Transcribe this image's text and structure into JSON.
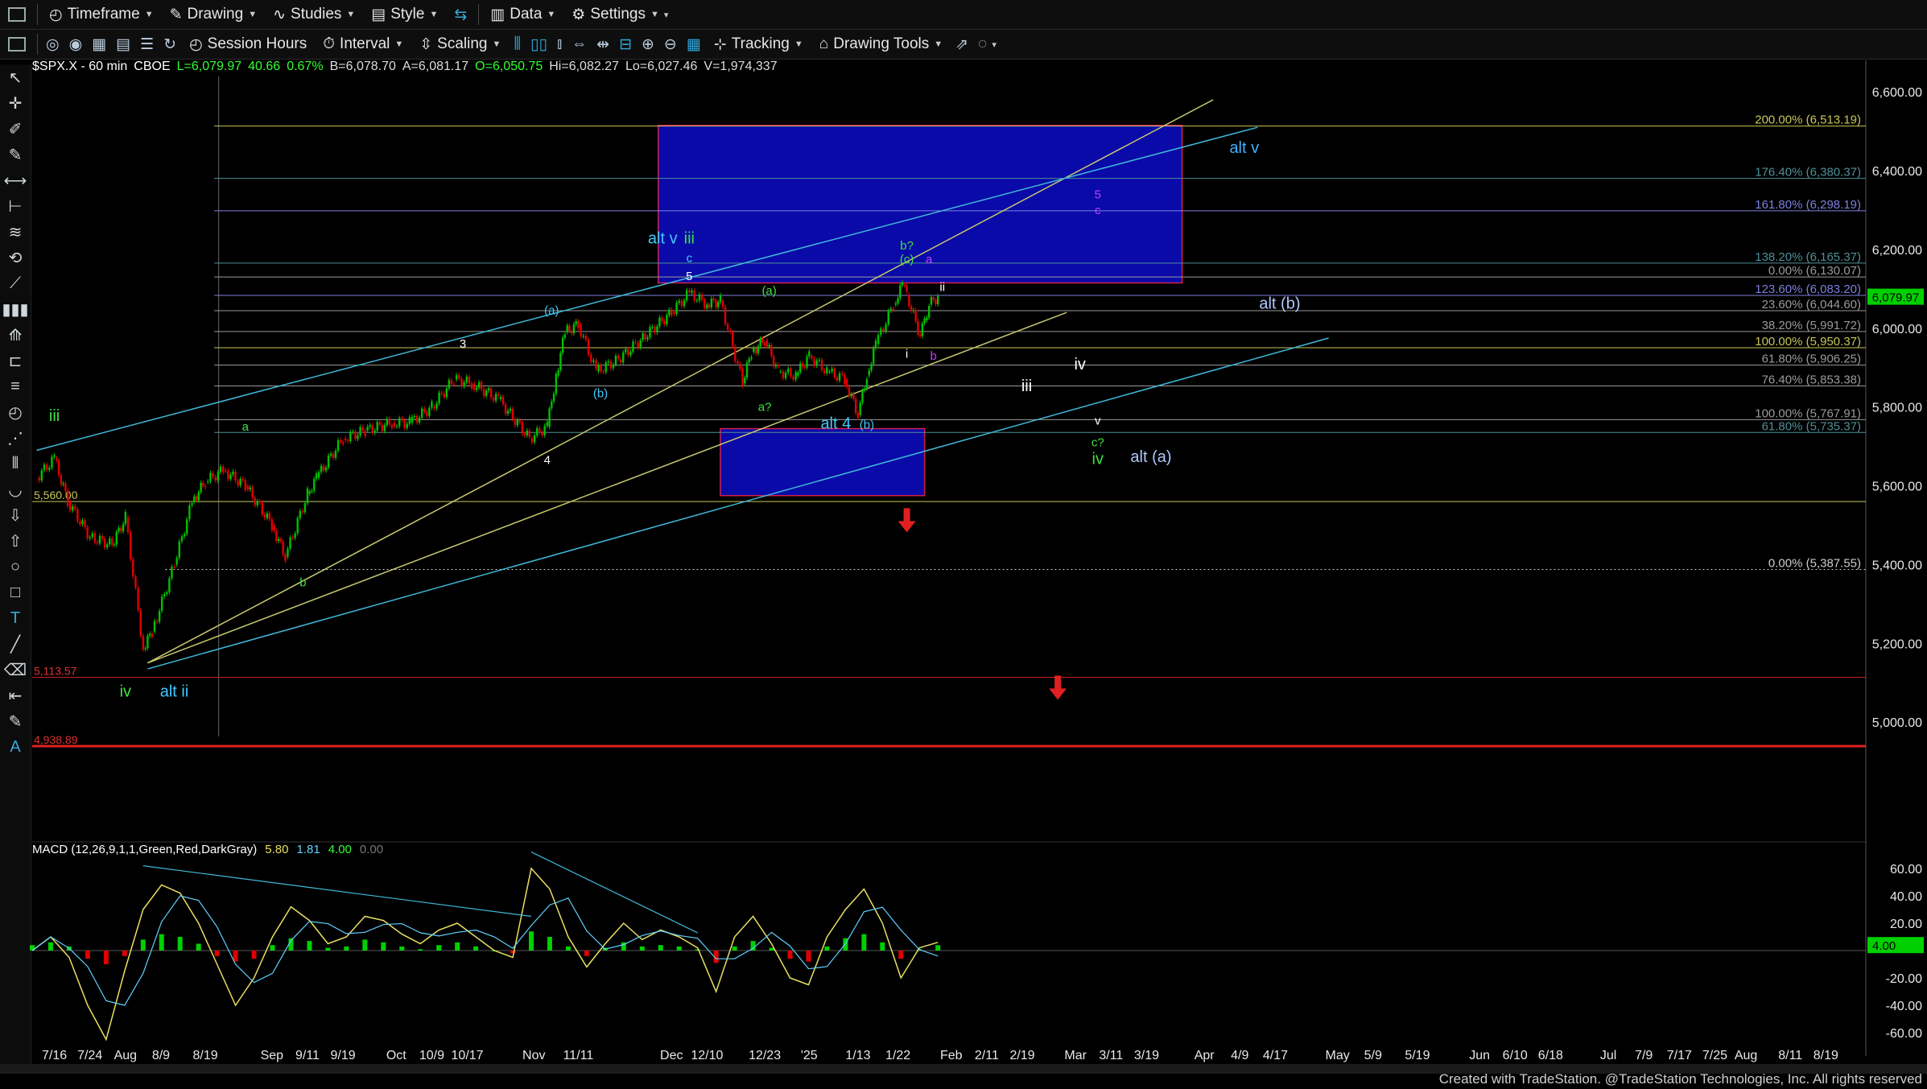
{
  "toolbar1": [
    {
      "label": "Timeframe",
      "icon": "clock-icon"
    },
    {
      "label": "Drawing",
      "icon": "pencil-icon"
    },
    {
      "label": "Studies",
      "icon": "studies-icon"
    },
    {
      "label": "Style",
      "icon": "style-icon"
    },
    {
      "label": "Data",
      "icon": "data-icon"
    },
    {
      "label": "Settings",
      "icon": "gear-icon"
    }
  ],
  "toolbar2": [
    {
      "label": "Session Hours",
      "icon": "session-icon"
    },
    {
      "label": "Interval",
      "icon": "interval-icon"
    },
    {
      "label": "Scaling",
      "icon": "scaling-icon"
    },
    {
      "label": "Tracking",
      "icon": "tracking-icon"
    },
    {
      "label": "Drawing Tools",
      "icon": "drawing-tools-icon"
    }
  ],
  "symbol_info": {
    "symbol": "$SPX.X - 60 min",
    "exchange": "CBOE",
    "last": "L=6,079.97",
    "change": "40.66",
    "pct": "0.67%",
    "bid": "B=6,078.70",
    "ask": "A=6,081.17",
    "open": "O=6,050.75",
    "high": "Hi=6,082.27",
    "low": "Lo=6,027.46",
    "volume": "V=1,974,337"
  },
  "macd_info": {
    "label": "MACD (12,26,9,1,1,Green,Red,DarkGray)",
    "v1": "5.80",
    "v2": "1.81",
    "v3": "4.00",
    "v4": "0.00"
  },
  "credit": "Created with TradeStation. @TradeStation Technologies, Inc. All rights reserved",
  "colors": {
    "bg": "#000000",
    "up": "#00c000",
    "down": "#e00000",
    "blue_box": "#0a0aa8",
    "fib": "#b9bf5e"
  },
  "chart_data": {
    "type": "line",
    "title": "$SPX.X - 60 min",
    "price_axis": {
      "ylim": [
        4800,
        6680
      ],
      "ticks": [
        "6,600.00",
        "6,400.00",
        "6,200.00",
        "6,000.00",
        "5,800.00",
        "5,600.00",
        "5,400.00",
        "5,200.00",
        "5,000.00"
      ],
      "tick_values": [
        6600,
        6400,
        6200,
        6000,
        5800,
        5600,
        5400,
        5200,
        5000
      ],
      "current_label": "6,079.97",
      "current_value": 6079.97
    },
    "time_axis": {
      "labels": [
        "7/16",
        "7/24",
        "Aug",
        "8/9",
        "8/19",
        "Sep",
        "9/11",
        "9/19",
        "Oct",
        "10/9",
        "10/17",
        "Nov",
        "11/11",
        "Dec",
        "12/10",
        "12/23",
        "'25",
        "1/13",
        "1/22",
        "Feb",
        "2/11",
        "2/19",
        "Mar",
        "3/11",
        "3/19",
        "Apr",
        "4/9",
        "4/17",
        "May",
        "5/9",
        "5/19",
        "Jun",
        "6/10",
        "6/18",
        "Jul",
        "7/9",
        "7/17",
        "7/25",
        "Aug",
        "8/11",
        "8/19"
      ],
      "dates": [
        "2024-07-16",
        "2024-07-24",
        "2024-08-01",
        "2024-08-09",
        "2024-08-19",
        "2024-09-03",
        "2024-09-11",
        "2024-09-19",
        "2024-10-01",
        "2024-10-09",
        "2024-10-17",
        "2024-11-01",
        "2024-11-11",
        "2024-12-02",
        "2024-12-10",
        "2024-12-23",
        "2025-01-02",
        "2025-01-13",
        "2025-01-22",
        "2025-02-03",
        "2025-02-11",
        "2025-02-19",
        "2025-03-03",
        "2025-03-11",
        "2025-03-19",
        "2025-04-01",
        "2025-04-09",
        "2025-04-17",
        "2025-05-01",
        "2025-05-09",
        "2025-05-19",
        "2025-06-02",
        "2025-06-10",
        "2025-06-18",
        "2025-07-01",
        "2025-07-09",
        "2025-07-17",
        "2025-07-25",
        "2025-08-01",
        "2025-08-11",
        "2025-08-19"
      ]
    },
    "price_series": {
      "name": "$SPX.X",
      "x": [
        "2024-07-12",
        "2024-07-16",
        "2024-07-19",
        "2024-07-24",
        "2024-07-29",
        "2024-08-01",
        "2024-08-05",
        "2024-08-07",
        "2024-08-12",
        "2024-08-16",
        "2024-08-19",
        "2024-08-23",
        "2024-08-28",
        "2024-09-03",
        "2024-09-06",
        "2024-09-11",
        "2024-09-13",
        "2024-09-19",
        "2024-09-24",
        "2024-09-30",
        "2024-10-04",
        "2024-10-09",
        "2024-10-14",
        "2024-10-18",
        "2024-10-24",
        "2024-10-31",
        "2024-11-04",
        "2024-11-06",
        "2024-11-08",
        "2024-11-11",
        "2024-11-15",
        "2024-11-20",
        "2024-11-25",
        "2024-12-02",
        "2024-12-06",
        "2024-12-10",
        "2024-12-13",
        "2024-12-18",
        "2024-12-20",
        "2024-12-23",
        "2024-12-26",
        "2024-12-30",
        "2025-01-02",
        "2025-01-06",
        "2025-01-10",
        "2025-01-13",
        "2025-01-15",
        "2025-01-17",
        "2025-01-21",
        "2025-01-23",
        "2025-01-24",
        "2025-01-27",
        "2025-01-28",
        "2025-01-29",
        "2025-01-31"
      ],
      "y": [
        5620,
        5670,
        5560,
        5470,
        5450,
        5520,
        5185,
        5230,
        5400,
        5560,
        5610,
        5640,
        5600,
        5500,
        5420,
        5580,
        5620,
        5720,
        5740,
        5760,
        5760,
        5800,
        5870,
        5860,
        5820,
        5720,
        5750,
        5880,
        5990,
        6010,
        5890,
        5920,
        5970,
        6040,
        6090,
        6060,
        6070,
        5860,
        5940,
        5970,
        5890,
        5880,
        5930,
        5890,
        5870,
        5780,
        5880,
        5960,
        6060,
        6110,
        6085,
        5980,
        6020,
        6060,
        6080
      ]
    },
    "horizontal_levels": [
      {
        "label": "200.00% (6,513.19)",
        "value": 6513.19,
        "color": "#c6c65a"
      },
      {
        "label": "176.40% (6,380.37)",
        "value": 6380.37,
        "color": "#4f8f96"
      },
      {
        "label": "161.80% (6,298.19)",
        "value": 6298.19,
        "color": "#7f7fe0"
      },
      {
        "label": "138.20% (6,165.37)",
        "value": 6165.37,
        "color": "#4f8f96"
      },
      {
        "label": "0.00% (6,130.07)",
        "value": 6130.07,
        "color": "#9a9a9a"
      },
      {
        "label": "123.60% (6,083.20)",
        "value": 6083.2,
        "color": "#7f7fe0"
      },
      {
        "label": "23.60% (6,044.60)",
        "value": 6044.6,
        "color": "#9a9a9a"
      },
      {
        "label": "38.20% (5,991.72)",
        "value": 5991.72,
        "color": "#9a9a9a"
      },
      {
        "label": "100.00% (5,950.37)",
        "value": 5950.37,
        "color": "#c6c65a"
      },
      {
        "label": "61.80% (5,906.25)",
        "value": 5906.25,
        "color": "#9a9a9a"
      },
      {
        "label": "76.40% (5,853.38)",
        "value": 5853.38,
        "color": "#9a9a9a"
      },
      {
        "label": "100.00% (5,767.91)",
        "value": 5767.91,
        "color": "#9a9a9a"
      },
      {
        "label": "61.80% (5,735.37)",
        "value": 5735.37,
        "color": "#4f8f96"
      },
      {
        "label": "0.00% (5,387.55)",
        "value": 5387.55,
        "color": "#cccccc"
      },
      {
        "label": "5,560.00",
        "value": 5560,
        "color": "#c6c65a"
      },
      {
        "label": "5,113.57",
        "value": 5113.57,
        "color": "#c02020"
      },
      {
        "label": "4,938.89",
        "value": 4938.89,
        "color": "#e02020"
      }
    ],
    "boxes": [
      {
        "x0": "2024-11-29",
        "x1": "2025-03-27",
        "y0": 6115,
        "y1": 6515,
        "color": "#0a0aa8"
      },
      {
        "x0": "2024-12-13",
        "x1": "2025-01-28",
        "y0": 5575,
        "y1": 5745,
        "color": "#0a0aa8"
      }
    ],
    "annotations": [
      {
        "text": "alt v",
        "x": "2025-04-10",
        "y": 6445,
        "color": "#40b0ff"
      },
      {
        "text": "5",
        "x": "2025-03-08",
        "y": 6330,
        "color": "#c040ff"
      },
      {
        "text": "c",
        "x": "2025-03-08",
        "y": 6290,
        "color": "#c040ff"
      },
      {
        "text": "alt v",
        "x": "2024-11-30",
        "y": 6215,
        "color": "#40c8ff"
      },
      {
        "text": "iii",
        "x": "2024-12-06",
        "y": 6215,
        "color": "#40e040"
      },
      {
        "text": "c",
        "x": "2024-12-06",
        "y": 6168,
        "color": "#40c8ff"
      },
      {
        "text": "5",
        "x": "2024-12-06",
        "y": 6122,
        "color": "#ffffff"
      },
      {
        "text": "b?",
        "x": "2025-01-24",
        "y": 6200,
        "color": "#40e040"
      },
      {
        "text": "(c)",
        "x": "2025-01-24",
        "y": 6165,
        "color": "#40e040"
      },
      {
        "text": "a",
        "x": "2025-01-29",
        "y": 6165,
        "color": "#c040ff"
      },
      {
        "text": "ii",
        "x": "2025-02-01",
        "y": 6095,
        "color": "#ffffff"
      },
      {
        "text": "alt (b)",
        "x": "2025-04-18",
        "y": 6050,
        "color": "#b0c8ff"
      },
      {
        "text": "(a)",
        "x": "2024-12-24",
        "y": 6085,
        "color": "#40e040"
      },
      {
        "text": "(a)",
        "x": "2024-11-05",
        "y": 6035,
        "color": "#40c8ff"
      },
      {
        "text": "3",
        "x": "2024-10-16",
        "y": 5950,
        "color": "#ffffff"
      },
      {
        "text": "i",
        "x": "2025-01-24",
        "y": 5925,
        "color": "#ffffff"
      },
      {
        "text": "b",
        "x": "2025-01-30",
        "y": 5920,
        "color": "#c040ff"
      },
      {
        "text": "iv",
        "x": "2025-03-04",
        "y": 5895,
        "color": "#ffffff"
      },
      {
        "text": "iii",
        "x": "2025-02-20",
        "y": 5840,
        "color": "#ffffff"
      },
      {
        "text": "(b)",
        "x": "2024-11-16",
        "y": 5825,
        "color": "#40c8ff"
      },
      {
        "text": "a?",
        "x": "2024-12-23",
        "y": 5790,
        "color": "#40e040"
      },
      {
        "text": "alt 4",
        "x": "2025-01-08",
        "y": 5745,
        "color": "#40c8ff"
      },
      {
        "text": "(b)",
        "x": "2025-01-15",
        "y": 5745,
        "color": "#40c8ff"
      },
      {
        "text": "v",
        "x": "2025-03-08",
        "y": 5755,
        "color": "#ffffff"
      },
      {
        "text": "c?",
        "x": "2025-03-08",
        "y": 5700,
        "color": "#40e040"
      },
      {
        "text": "iv",
        "x": "2025-03-08",
        "y": 5655,
        "color": "#40e040"
      },
      {
        "text": "alt (a)",
        "x": "2025-03-20",
        "y": 5660,
        "color": "#b0c8ff"
      },
      {
        "text": "a",
        "x": "2024-08-28",
        "y": 5740,
        "color": "#40e040"
      },
      {
        "text": "4",
        "x": "2024-11-04",
        "y": 5655,
        "color": "#ffffff"
      },
      {
        "text": "iii",
        "x": "2024-07-16",
        "y": 5765,
        "color": "#40e040"
      },
      {
        "text": "b",
        "x": "2024-09-10",
        "y": 5345,
        "color": "#40e040"
      },
      {
        "text": "iv",
        "x": "2024-08-01",
        "y": 5065,
        "color": "#40e040"
      },
      {
        "text": "alt ii",
        "x": "2024-08-12",
        "y": 5065,
        "color": "#40c8ff"
      }
    ],
    "trendlines": [
      {
        "color": "#c8c870",
        "from": [
          "2024-08-06",
          5150
        ],
        "to": [
          "2025-04-03",
          6580
        ]
      },
      {
        "color": "#c8c870",
        "from": [
          "2024-08-06",
          5150
        ],
        "to": [
          "2025-03-01",
          6040
        ]
      },
      {
        "color": "#40b8d8",
        "from": [
          "2024-07-12",
          5690
        ],
        "to": [
          "2025-04-13",
          6510
        ]
      },
      {
        "color": "#40b8d8",
        "from": [
          "2024-08-06",
          5135
        ],
        "to": [
          "2025-04-29",
          5975
        ]
      }
    ],
    "arrows": [
      {
        "x": "2025-01-24",
        "y": 5490
      },
      {
        "x": "2025-02-27",
        "y": 5065
      }
    ],
    "macd_panel": {
      "ylim": [
        -70,
        70
      ],
      "ticks": [
        "60.00",
        "40.00",
        "20.00",
        "-20.00",
        "-40.00",
        "-60.00"
      ],
      "tick_values": [
        60,
        40,
        20,
        -20,
        -40,
        -60
      ],
      "current_label": "4.00",
      "macd": [
        0,
        10,
        -5,
        -40,
        -65,
        -15,
        30,
        48,
        42,
        20,
        -10,
        -40,
        -20,
        10,
        32,
        22,
        5,
        10,
        25,
        22,
        12,
        5,
        15,
        20,
        10,
        0,
        -5,
        60,
        45,
        10,
        -12,
        5,
        20,
        8,
        15,
        10,
        2,
        -30,
        10,
        25,
        5,
        -20,
        -25,
        10,
        30,
        45,
        20,
        -20,
        2,
        6
      ],
      "histogram": [
        4,
        6,
        3,
        -6,
        -10,
        -4,
        8,
        12,
        10,
        5,
        -4,
        -8,
        -6,
        4,
        9,
        7,
        2,
        3,
        8,
        6,
        3,
        1,
        4,
        6,
        3,
        0,
        -2,
        14,
        10,
        3,
        -4,
        2,
        6,
        3,
        4,
        3,
        1,
        -9,
        3,
        7,
        2,
        -6,
        -8,
        3,
        9,
        12,
        6,
        -6,
        1,
        4
      ]
    }
  }
}
